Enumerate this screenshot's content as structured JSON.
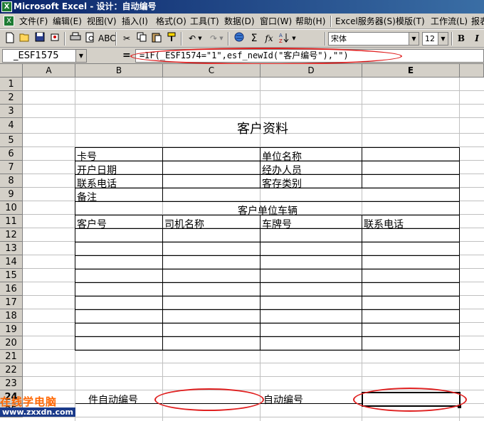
{
  "window": {
    "title": "Microsoft Excel - 设计：自动编号"
  },
  "menu": {
    "items": [
      "文件(F)",
      "编辑(E)",
      "视图(V)",
      "插入(I)",
      "格式(O)",
      "工具(T)",
      "数据(D)",
      "窗口(W)",
      "帮助(H)",
      "Excel服务器(S)",
      "模版(T)",
      "工作流(L)",
      "报表"
    ]
  },
  "toolbar": {
    "font_name": "宋体",
    "font_size": "12",
    "bold_label": "B",
    "sum_label": "Σ",
    "function_label": "fx"
  },
  "formula_bar": {
    "name_box": "_ESF1575",
    "equals": "=",
    "formula": "=IF(_ESF1574=\"1\",esf_newId(\"客户编号\"),\"\")"
  },
  "sheet": {
    "columns": [
      "A",
      "B",
      "C",
      "D",
      "E"
    ],
    "active_column": "E",
    "rows": [
      "1",
      "2",
      "3",
      "4",
      "5",
      "6",
      "7",
      "8",
      "9",
      "10",
      "11",
      "12",
      "13",
      "14",
      "15",
      "16",
      "17",
      "18",
      "19",
      "20",
      "21",
      "22",
      "23",
      "24",
      "25"
    ],
    "active_row": "24",
    "title": "客户资料",
    "labels": {
      "card_no": "卡号",
      "open_date": "开户日期",
      "phone": "联系电话",
      "remark": "备注",
      "unit_name": "单位名称",
      "handler": "经办人员",
      "deposit_type": "客存类别",
      "vehicles_section": "客户单位车辆",
      "customer_no": "客户号",
      "driver_name": "司机名称",
      "plate_no": "车牌号",
      "contact_phone": "联系电话",
      "auto_cond": "件自动编号",
      "auto_no": "自动编号"
    }
  },
  "watermark": {
    "line1": "在线学电脑",
    "line2": "www.zxxdn.com"
  }
}
